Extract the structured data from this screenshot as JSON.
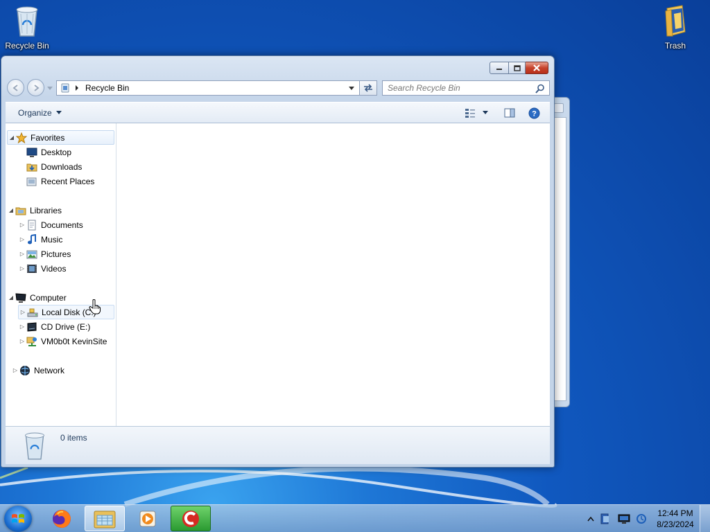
{
  "desktop": {
    "icons": [
      {
        "label": "Recycle Bin",
        "icon": "recycle-bin-icon"
      },
      {
        "label": "Trash",
        "icon": "folder-icon"
      }
    ]
  },
  "window": {
    "address": {
      "crumb": "Recycle Bin"
    },
    "search": {
      "placeholder": "Search Recycle Bin"
    },
    "toolbar": {
      "organize": "Organize"
    },
    "nav": {
      "favorites": {
        "label": "Favorites",
        "items": [
          "Desktop",
          "Downloads",
          "Recent Places"
        ]
      },
      "libraries": {
        "label": "Libraries",
        "items": [
          "Documents",
          "Music",
          "Pictures",
          "Videos"
        ]
      },
      "computer": {
        "label": "Computer",
        "items": [
          "Local Disk (C:)",
          "CD Drive (E:)",
          "VM0b0t KevinSite"
        ]
      },
      "network": {
        "label": "Network"
      }
    },
    "status": {
      "items_count": "0 items"
    }
  },
  "taskbar": {
    "apps": [
      "firefox-icon",
      "windows-explorer-icon",
      "media-player-icon",
      "ccleaner-icon"
    ],
    "clock": {
      "time": "12:44 PM",
      "date": "8/23/2024"
    }
  },
  "colors": {
    "accent": "#1e395b",
    "close_button": "#c7432c",
    "desktop": "#1058bf"
  }
}
